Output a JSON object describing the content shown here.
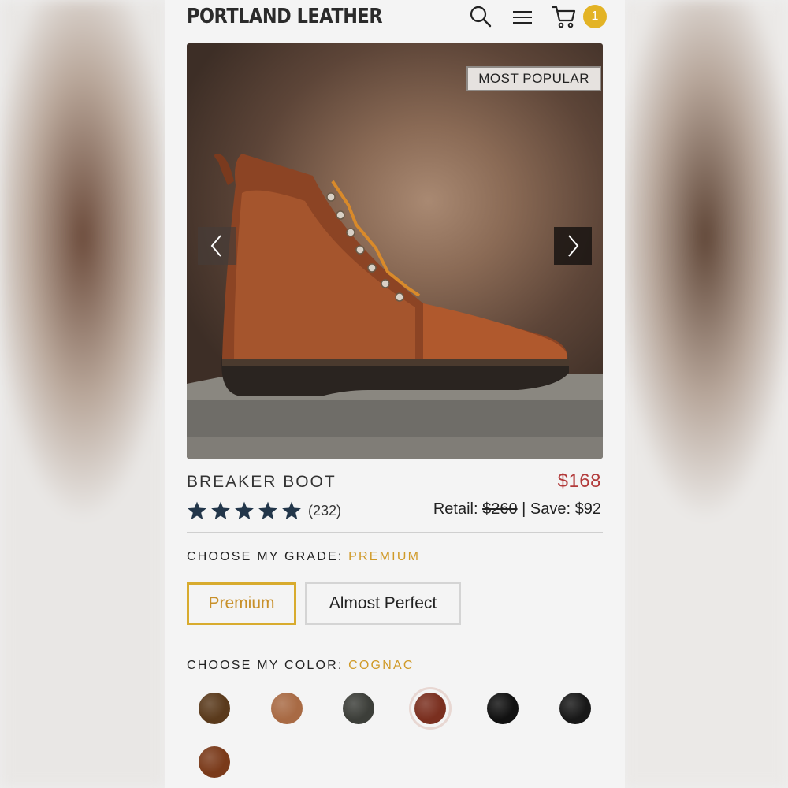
{
  "header": {
    "brand": "PORTLAND LEATHER",
    "icons": [
      "search-icon",
      "menu-icon",
      "cart-icon"
    ],
    "cart_count": "1"
  },
  "hero": {
    "badge": "MOST POPULAR",
    "prev_icon": "chevron-left-icon",
    "next_icon": "chevron-right-icon"
  },
  "product": {
    "name": "BREAKER BOOT",
    "price": "$168",
    "rating": 5,
    "rating_max": 5,
    "review_count": "(232)",
    "retail_label": "Retail:",
    "retail_price": "$260",
    "separator": "|",
    "save_text": "Save: $92"
  },
  "grade": {
    "label": "CHOOSE MY GRADE:",
    "selected": "PREMIUM",
    "options": [
      "Premium",
      "Almost Perfect"
    ]
  },
  "color": {
    "label": "CHOOSE MY COLOR:",
    "selected": "COGNAC",
    "swatches": [
      {
        "color": "#5a3a1c",
        "selected": false
      },
      {
        "color": "#a86a44",
        "selected": false
      },
      {
        "color": "#3c3e39",
        "selected": false
      },
      {
        "color": "#7a2f1f",
        "selected": true
      },
      {
        "color": "#111111",
        "selected": false
      },
      {
        "color": "#181818",
        "selected": false
      },
      {
        "color": "#7a3a1a",
        "selected": false
      }
    ]
  },
  "colors": {
    "accent_gold": "#d09a28",
    "price_red": "#b23a3a",
    "star_navy": "#22364a",
    "badge_yellow": "#e3b325"
  }
}
